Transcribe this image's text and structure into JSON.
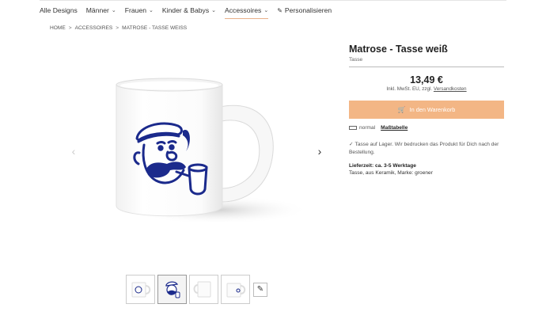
{
  "nav": {
    "items": [
      {
        "label": "Alle Designs",
        "has_chevron": false
      },
      {
        "label": "Männer",
        "has_chevron": true
      },
      {
        "label": "Frauen",
        "has_chevron": true
      },
      {
        "label": "Kinder & Babys",
        "has_chevron": true
      },
      {
        "label": "Accessoires",
        "has_chevron": true,
        "active": true
      },
      {
        "label": "Personalisieren",
        "has_chevron": false,
        "icon": "pencil-icon"
      }
    ]
  },
  "breadcrumb": {
    "items": [
      "HOME",
      "ACCESSOIRES",
      "MATROSE - TASSE WEISS"
    ],
    "separator": ">"
  },
  "product": {
    "title": "Matrose - Tasse weiß",
    "subtitle": "Tasse",
    "price": "13,49 €",
    "tax_prefix": "Inkl. MwSt. EU, zzgl. ",
    "tax_link": "Versandkosten",
    "cart_button": "In den Warenkorb",
    "size_label": "normal",
    "size_table_link": "Maßtabelle",
    "stock_text": "Tasse auf Lager. Wir bedrucken das Produkt für Dich nach der Bestellung.",
    "delivery_label": "Lieferzeit:",
    "delivery_value": "ca. 3-5 Werktage",
    "material_text": "Tasse, aus Keramik, Marke: groener"
  },
  "gallery": {
    "prev_icon": "chevron-left-icon",
    "next_icon": "chevron-right-icon",
    "selected_thumb": 1,
    "thumb_count": 4
  },
  "colors": {
    "accent": "#f3b685",
    "print_blue": "#1b2a8c"
  }
}
